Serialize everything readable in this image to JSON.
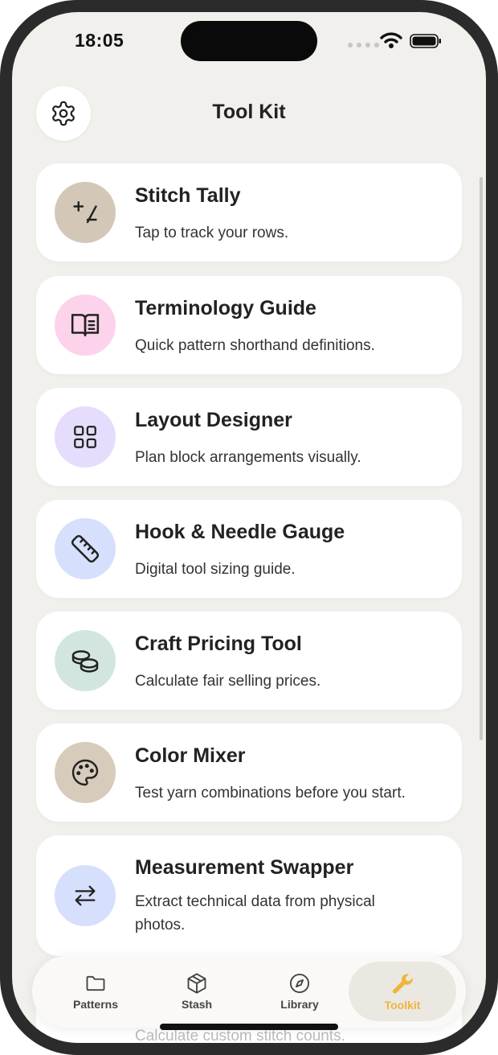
{
  "status_bar": {
    "time": "18:05"
  },
  "header": {
    "title": "Tool Kit",
    "settings_icon": "gear-icon"
  },
  "tools": [
    {
      "title": "Stitch Tally",
      "description": "Tap to track your rows.",
      "icon": "plus-minus-icon",
      "icon_bg": "#d3c8b8"
    },
    {
      "title": "Terminology Guide",
      "description": "Quick pattern shorthand definitions.",
      "icon": "book-icon",
      "icon_bg": "#fcd3ea"
    },
    {
      "title": "Layout Designer",
      "description": "Plan block arrangements visually.",
      "icon": "grid-icon",
      "icon_bg": "#e6dcfb"
    },
    {
      "title": "Hook & Needle Gauge",
      "description": "Digital tool sizing guide.",
      "icon": "ruler-icon",
      "icon_bg": "#d6dffc"
    },
    {
      "title": "Craft Pricing Tool",
      "description": "Calculate fair selling prices.",
      "icon": "coins-icon",
      "icon_bg": "#d2e6df"
    },
    {
      "title": "Color Mixer",
      "description": "Test yarn combinations before you start.",
      "icon": "palette-icon",
      "icon_bg": "#d7cbbb"
    },
    {
      "title": "Measurement Swapper",
      "description": "Extract technical data from physical photos.",
      "icon": "swap-arrows-icon",
      "icon_bg": "#d6dffc"
    }
  ],
  "peek_item": {
    "description": "Calculate custom stitch counts."
  },
  "tab_bar": {
    "tabs": [
      {
        "label": "Patterns",
        "icon": "folder-icon",
        "active": false
      },
      {
        "label": "Stash",
        "icon": "box-icon",
        "active": false
      },
      {
        "label": "Library",
        "icon": "compass-icon",
        "active": false
      },
      {
        "label": "Toolkit",
        "icon": "wrench-icon",
        "active": true
      }
    ]
  },
  "colors": {
    "background": "#f1f0ec",
    "accent": "#f0b43c",
    "card": "#ffffff"
  }
}
